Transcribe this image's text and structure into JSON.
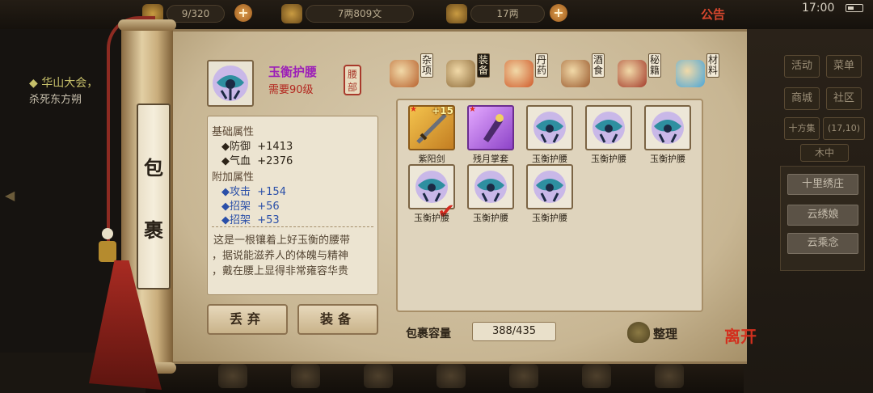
{
  "hud": {
    "capacity_partial": "9/320",
    "money": "7两809文",
    "silver": "17两",
    "notice": "公告",
    "time": "17:00"
  },
  "quest": {
    "title": "◆ 华山大会，",
    "subtitle": "杀死东方朔"
  },
  "sidebar": {
    "buttons": [
      "活动",
      "菜单",
      "商城",
      "社区",
      "十方集",
      "(17,10)",
      "木中"
    ],
    "npcs": [
      "十里绣庄",
      "云绣娘",
      "云乘念"
    ]
  },
  "scroll": {
    "title_chars": [
      "包",
      "裹"
    ]
  },
  "item": {
    "name": "玉衡护腰",
    "requirement": "需要90级",
    "slot": "腰部",
    "base_header": "基础属性",
    "base_stats": [
      {
        "label": "◆防御",
        "value": "+1413"
      },
      {
        "label": "◆气血",
        "value": "+2376"
      }
    ],
    "extra_header": "附加属性",
    "extra_stats": [
      {
        "label": "◆攻击",
        "value": "+154"
      },
      {
        "label": "◆招架",
        "value": "+56"
      },
      {
        "label": "◆招架",
        "value": "+53"
      }
    ],
    "description": [
      "这是一根镶着上好玉衡的腰带",
      "，据说能滋养人的体魄与精神",
      "，戴在腰上显得非常雍容华贵"
    ]
  },
  "actions": {
    "discard": "丢弃",
    "equip": "装备"
  },
  "tabs": [
    {
      "label": "杂项",
      "icon": "jar-icon",
      "color": "#b8622e"
    },
    {
      "label": "装备",
      "icon": "scroll-weapon-icon",
      "color": "#8d6b3a"
    },
    {
      "label": "丹药",
      "icon": "pills-icon",
      "color": "#d05a2a"
    },
    {
      "label": "酒食",
      "icon": "food-icon",
      "color": "#9a5a2e"
    },
    {
      "label": "秘籍",
      "icon": "books-icon",
      "color": "#a33a2a"
    },
    {
      "label": "材料",
      "icon": "gem-icon",
      "color": "#4aa6d8"
    }
  ],
  "active_tab": "装备",
  "inventory": [
    {
      "name": "紫阳剑",
      "style": "gold",
      "plus": "+15",
      "star": true,
      "check": false
    },
    {
      "name": "残月掌套",
      "style": "purple",
      "plus": "",
      "star": true,
      "check": false
    },
    {
      "name": "玉衡护腰",
      "style": "plain",
      "plus": "",
      "star": false,
      "check": false
    },
    {
      "name": "玉衡护腰",
      "style": "plain",
      "plus": "",
      "star": false,
      "check": false
    },
    {
      "name": "玉衡护腰",
      "style": "plain",
      "plus": "",
      "star": false,
      "check": false
    },
    {
      "name": "玉衡护腰",
      "style": "plain",
      "plus": "",
      "star": false,
      "check": true
    },
    {
      "name": "玉衡护腰",
      "style": "plain",
      "plus": "",
      "star": false,
      "check": false
    },
    {
      "name": "玉衡护腰",
      "style": "plain",
      "plus": "",
      "star": false,
      "check": false
    }
  ],
  "footer": {
    "capacity_label": "包裹容量",
    "capacity_value": "388/435",
    "sort_label": "整理",
    "leave_label": "离开"
  }
}
